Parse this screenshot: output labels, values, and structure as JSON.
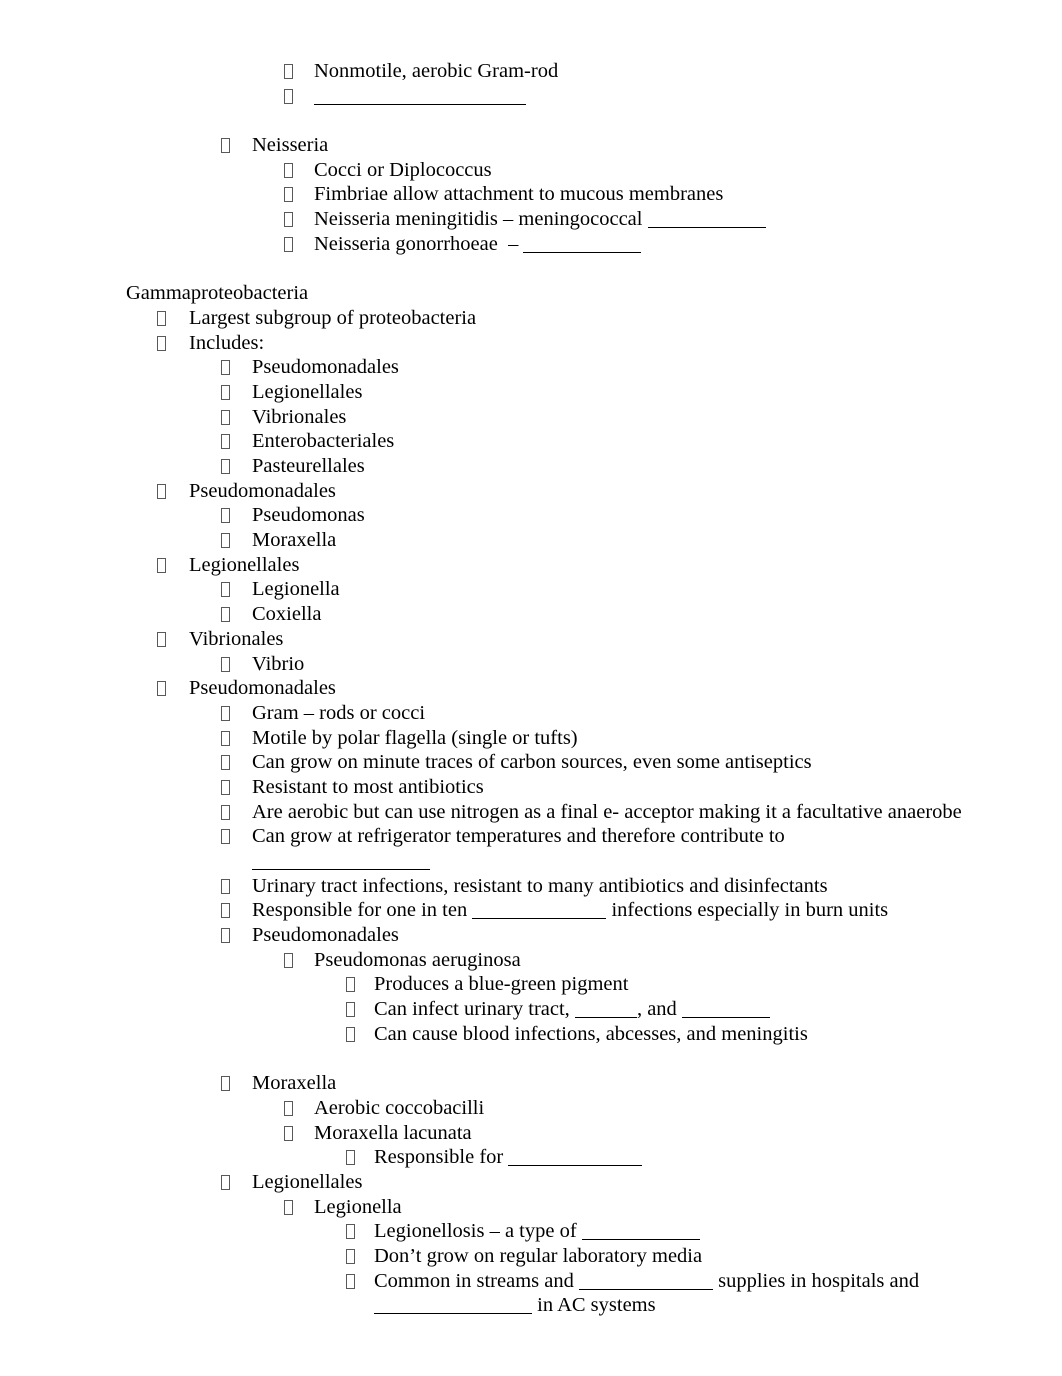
{
  "document": {
    "title": "Gammaproteobacteria lecture outline",
    "background_color": "#ffffff",
    "text_color": "#000000",
    "bullet_glyph": "missing-glyph-box",
    "bullet_color": "#595959"
  },
  "outline": {
    "nonmotile_line": "Nonmotile, aerobic Gram-rod",
    "neisseria_heading": "Neisseria",
    "neisseria_cocci": "Cocci or Diplococcus",
    "neisseria_fimbriae": "Fimbriae allow attachment to mucous membranes",
    "neisseria_meningitidis": "Neisseria meningitidis – meningococcal ",
    "neisseria_gonorrhoeae": "Neisseria gonorrhoeae  – ",
    "gamma_heading": "Gammaproteobacteria",
    "gamma_largest": "Largest subgroup of proteobacteria",
    "gamma_includes": "Includes:",
    "includes_1": "Pseudomonadales",
    "includes_2": "Legionellales",
    "includes_3": "Vibrionales",
    "includes_4": "Enterobacteriales",
    "includes_5": "Pasteurellales",
    "pseudomonadales_h1": "Pseudomonadales",
    "pseudomonas": "Pseudomonas",
    "moraxella": "Moraxella",
    "legionellales_h1": "Legionellales",
    "legionella": "Legionella",
    "coxiella": "Coxiella",
    "vibrionales_h1": "Vibrionales",
    "vibrio": "Vibrio",
    "pseudomonadales_h2": "Pseudomonadales",
    "p_gram": "Gram – rods or cocci",
    "p_motile": "Motile by polar flagella (single or tufts)",
    "p_carbon": "Can grow on minute traces of carbon sources, even some antiseptics",
    "p_resistant": "Resistant to most antibiotics",
    "p_aerobic": "Are aerobic but can use nitrogen as a final e- acceptor making it a facultative anaerobe",
    "p_refrigerator": "Can grow at refrigerator temperatures and therefore contribute to",
    "p_uti": "Urinary tract infections, resistant to many antibiotics and disinfectants",
    "p_one_in_ten_pre": "Responsible for one in ten ",
    "p_one_in_ten_post": " infections especially in burn units",
    "pseudomonadales_h3": "Pseudomonadales",
    "p_aeruginosa": "Pseudomonas aeruginosa",
    "pa_pigment": "Produces a blue-green pigment",
    "pa_infect_pre": "Can infect urinary tract, ",
    "pa_infect_mid": ", and ",
    "pa_blood": "Can cause blood infections, abcesses, and meningitis",
    "moraxella_h2": "Moraxella",
    "m_aerobic": "Aerobic coccobacilli",
    "m_lacunata": "Moraxella lacunata",
    "m_responsible_pre": "Responsible for ",
    "legionellales_h2": "Legionellales",
    "legionella_h2": "Legionella",
    "l_legionellosis_pre": "Legionellosis – a type of ",
    "l_dont_grow": "Don’t grow on regular laboratory media",
    "l_common_pre": "Common in streams and ",
    "l_common_post": " supplies in hospitals and",
    "l_common_post2": " in AC systems"
  }
}
